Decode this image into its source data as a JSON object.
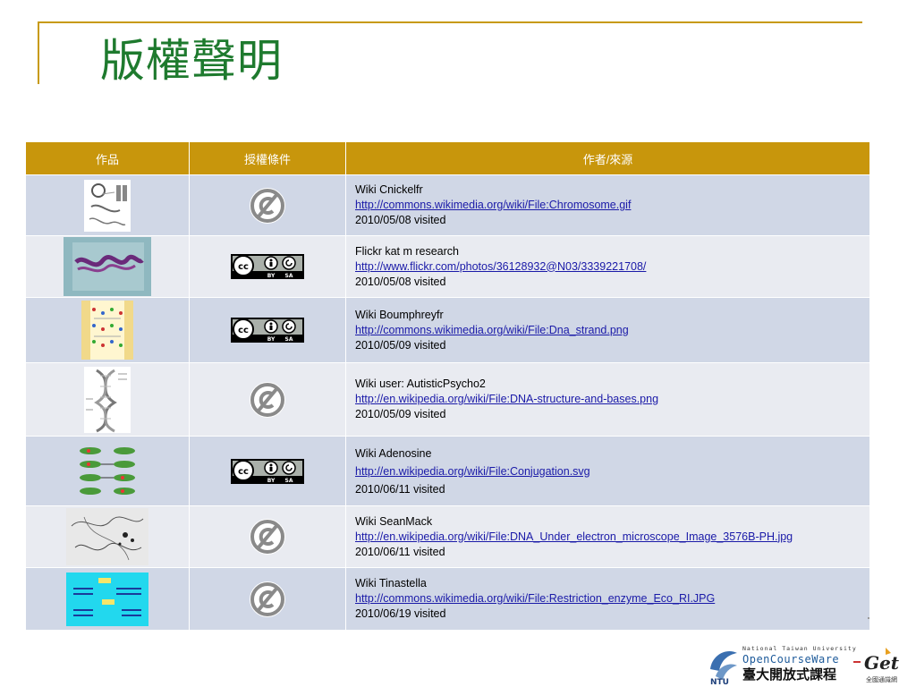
{
  "title": "版權聲明",
  "table": {
    "headers": [
      "作品",
      "授權條件",
      "作者/來源"
    ],
    "rows": [
      {
        "work_icon": "chromosome-drawing-icon",
        "license": "public-domain",
        "author": "Wiki Cnickelfr",
        "url": "http://commons.wikimedia.org/wiki/File:Chromosome.gif",
        "date": "2010/05/08 visited"
      },
      {
        "work_icon": "chromosome-photo-icon",
        "license": "cc-by-sa",
        "author": "Flickr kat m research",
        "url": "http://www.flickr.com/photos/36128932@N03/3339221708/",
        "date": "2010/05/08 visited"
      },
      {
        "work_icon": "dna-strand-icon",
        "license": "cc-by-sa",
        "author": "Wiki Boumphreyfr",
        "url": "http://commons.wikimedia.org/wiki/File:Dna_strand.png",
        "date": "2010/05/09 visited"
      },
      {
        "work_icon": "dna-helix-icon",
        "license": "public-domain",
        "author": "Wiki user: AutisticPsycho2",
        "url": "http://en.wikipedia.org/wiki/File:DNA-structure-and-bases.png",
        "date": "2010/05/09 visited"
      },
      {
        "work_icon": "conjugation-diagram-icon",
        "license": "cc-by-sa",
        "author": "Wiki Adenosine",
        "url": "http://en.wikipedia.org/wiki/File:Conjugation.svg",
        "date": "2010/06/11 visited"
      },
      {
        "work_icon": "electron-microscope-icon",
        "license": "public-domain",
        "author": "Wiki SeanMack",
        "url": "http://en.wikipedia.org/wiki/File:DNA_Under_electron_microscope_Image_3576B-PH.jpg",
        "date": "2010/06/11 visited"
      },
      {
        "work_icon": "restriction-enzyme-icon",
        "license": "public-domain",
        "author": "Wiki Tinastella",
        "url": "http://commons.wikimedia.org/wiki/File:Restriction_enzyme_Eco_RI.JPG",
        "date": "2010/06/19 visited"
      }
    ]
  },
  "badge": {
    "cc": "cc",
    "by": "BY",
    "sa": "SA"
  },
  "footer": {
    "university": "National Taiwan University",
    "ocw": "OpenCourseWare",
    "ntu": "NTU",
    "chinese": "臺大開放式課程",
    "get": "Get",
    "get_sub": "全國通識網"
  },
  "colors": {
    "accent": "#c8960c",
    "title": "#1e7a2e",
    "row_odd": "#d0d7e6",
    "row_even": "#e9ebf1",
    "link": "#1a1aa8"
  }
}
